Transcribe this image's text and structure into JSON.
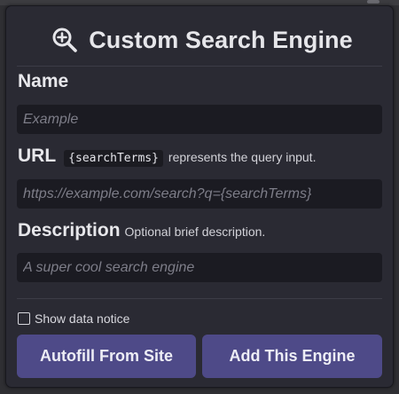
{
  "header": {
    "title": "Custom Search Engine",
    "icon": "zoom-in-icon"
  },
  "name": {
    "label": "Name",
    "placeholder": "Example",
    "value": ""
  },
  "url": {
    "label": "URL",
    "code_token": "{searchTerms}",
    "hint": "represents the query input.",
    "placeholder": "https://example.com/search?q={searchTerms}",
    "value": ""
  },
  "description": {
    "label": "Description",
    "hint": "Optional brief description.",
    "placeholder": "A super cool search engine",
    "value": ""
  },
  "data_notice": {
    "label": "Show data notice",
    "checked": false
  },
  "buttons": {
    "autofill": "Autofill From Site",
    "add": "Add This Engine"
  },
  "colors": {
    "panel_bg": "#2a2a33",
    "field_bg": "#1b1b22",
    "button_bg": "#4e4a88",
    "text": "#e6e6ea",
    "placeholder": "#7d7d88"
  }
}
